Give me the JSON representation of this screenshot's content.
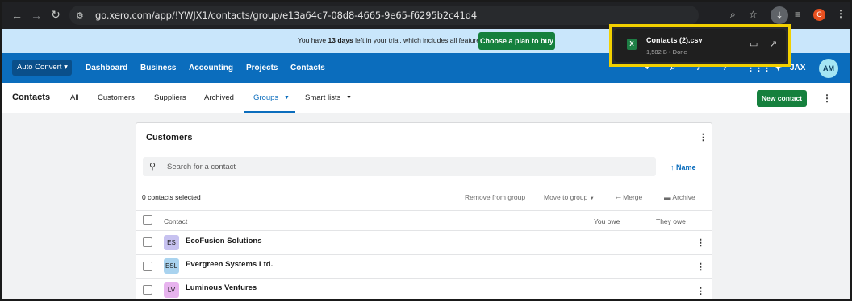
{
  "browser": {
    "url": "go.xero.com/app/!YWJX1/contacts/group/e13a64c7-08d8-4665-9e65-f6295b2c41d4",
    "profile_initial": "C"
  },
  "trial_banner": {
    "text_prefix": "You have ",
    "days": "13 days",
    "text_suffix": " left in your trial, which includes all features",
    "cta_label": "Choose a plan to buy"
  },
  "download": {
    "file_name": "Contacts (2).csv",
    "meta": "1,582 B • Done",
    "file_icon_letter": "X"
  },
  "main_nav": {
    "org_label": "Auto Convert ▾",
    "items": [
      "Dashboard",
      "Business",
      "Accounting",
      "Projects",
      "Contacts"
    ],
    "jax_label": "JAX",
    "avatar_initials": "AM"
  },
  "contacts_nav": {
    "title": "Contacts",
    "items": [
      "All",
      "Customers",
      "Suppliers",
      "Archived",
      "Groups",
      "Smart lists"
    ],
    "active": "Groups",
    "new_contact_label": "New contact"
  },
  "group_card": {
    "title": "Customers",
    "search_placeholder": "Search for a contact",
    "sort_label": "Name",
    "selected_text": "0 contacts selected",
    "actions": {
      "remove": "Remove from group",
      "move": "Move to group",
      "merge": "Merge",
      "archive": "Archive"
    },
    "columns": {
      "contact": "Contact",
      "you_owe": "You owe",
      "they_owe": "They owe"
    },
    "rows": [
      {
        "initials": "ES",
        "name": "EcoFusion Solutions",
        "avatar_color": "#c7c2f0"
      },
      {
        "initials": "ESL",
        "name": "Evergreen Systems Ltd.",
        "avatar_color": "#a9d3ef"
      },
      {
        "initials": "LV",
        "name": "Luminous Ventures",
        "avatar_color": "#e7b3ee"
      }
    ]
  },
  "colors": {
    "browser_bar": "#202124",
    "trial_banner": "#c9e6fb",
    "xero_blue": "#0b6dbd",
    "green_button": "#15803d",
    "highlight_border": "#f2d000"
  }
}
